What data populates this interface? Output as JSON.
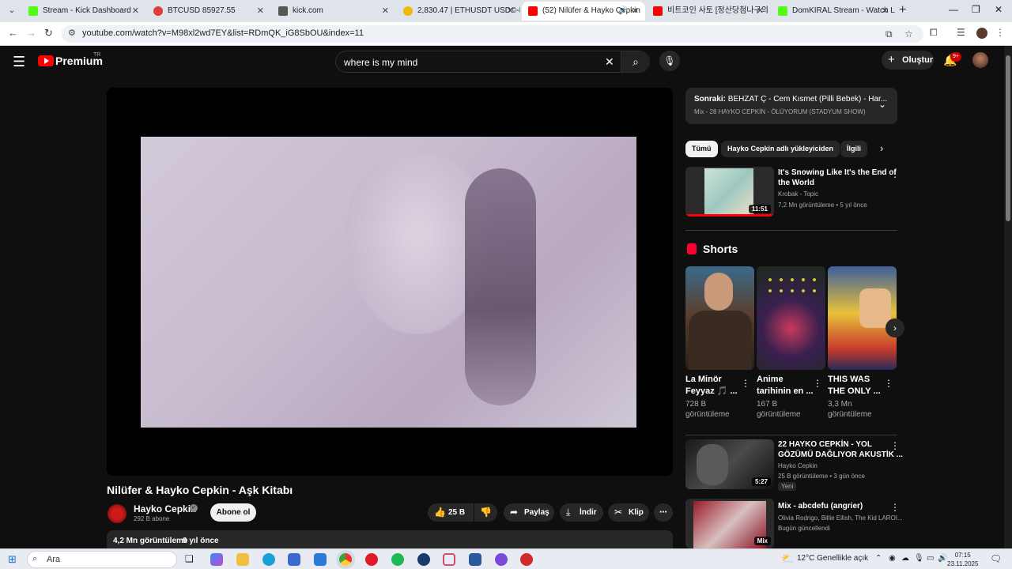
{
  "browser": {
    "tabs": [
      {
        "title": "Stream - Kick Dashboard",
        "color": "#53fc18"
      },
      {
        "title": "BTCUSD 85927.55",
        "color": "#e03c3c"
      },
      {
        "title": "kick.com",
        "color": "#555555"
      },
      {
        "title": "2,830.47 | ETHUSDT USD©-Ma",
        "color": "#f0b90b"
      },
      {
        "title": "(52) Nilüfer & Hayko Cepkin",
        "color": "#ff0000"
      },
      {
        "title": "비트코인 사토 [정산당첨나구의",
        "color": "#ff0000"
      },
      {
        "title": "DomKIRAL Stream - Watch Live",
        "color": "#53fc18"
      }
    ],
    "url": "youtube.com/watch?v=M98xl2wd7EY&list=RDmQK_iG8SbOU&index=11"
  },
  "youtube": {
    "logo_text": "Premium",
    "region": "TR",
    "search_query": "where is my mind",
    "create_label": "Oluştur",
    "notif_count": "9+"
  },
  "video": {
    "title": "Nilüfer & Hayko Cepkin - Aşk Kitabı",
    "channel": "Hayko Cepkin",
    "subscribers": "292 B abone",
    "subscribe_label": "Abone ol",
    "likes": "25 B",
    "share_label": "Paylaş",
    "download_label": "İndir",
    "clip_label": "Klip",
    "views": "4,2 Mn görüntüleme",
    "age": "9 yıl önce"
  },
  "up_next": {
    "prefix": "Sonraki:",
    "title": "BEHZAT Ç - Cem Kısmet (Pilli Bebek) - Har...",
    "mix": "Mix - 28 HAYKO CEPKİN - ÖLÜYORUM (STADYUM SHOW)"
  },
  "chips": [
    "Tümü",
    "Hayko Cepkin adlı yükleyiciden",
    "İlgili"
  ],
  "related": [
    {
      "title_l1": "It's Snowing Like It's the End of",
      "title_l2": "the World",
      "channel": "Krobak - Topic",
      "stats": "7,2 Mn görüntüleme • 5 yıl önce",
      "duration": "11:51"
    },
    {
      "title_l1": "22 HAYKO CEPKİN - YOL",
      "title_l2": "GÖZÜMÜ DAĞLIYOR AKUSTİK ...",
      "channel": "Hayko Cepkin",
      "stats": "25 B görüntüleme • 3 gün önce",
      "duration": "5:27",
      "tag": "Yeni"
    },
    {
      "title_l1": "Mix - abcdefu (angrier)",
      "title_l2": "",
      "channel": "Olivia Rodrigo, Billie Eilish, The Kid LAROI...",
      "stats": "Bugün güncellendi",
      "duration": "Mix"
    }
  ],
  "shorts": {
    "heading": "Shorts",
    "items": [
      {
        "title_l1": "La Minör",
        "title_l2": "Feyyaz 🎵 ...",
        "views_l1": "728 B",
        "views_l2": "görüntüleme"
      },
      {
        "title_l1": "Anime",
        "title_l2": "tarihinin en ...",
        "views_l1": "167 B",
        "views_l2": "görüntüleme"
      },
      {
        "title_l1": "THIS WAS",
        "title_l2": "THE ONLY ...",
        "views_l1": "3,3 Mn",
        "views_l2": "görüntüleme"
      }
    ]
  },
  "taskbar": {
    "search_placeholder": "Ara",
    "weather": "12°C  Genellikle açık",
    "time": "07:15",
    "date": "23.11.2025"
  }
}
